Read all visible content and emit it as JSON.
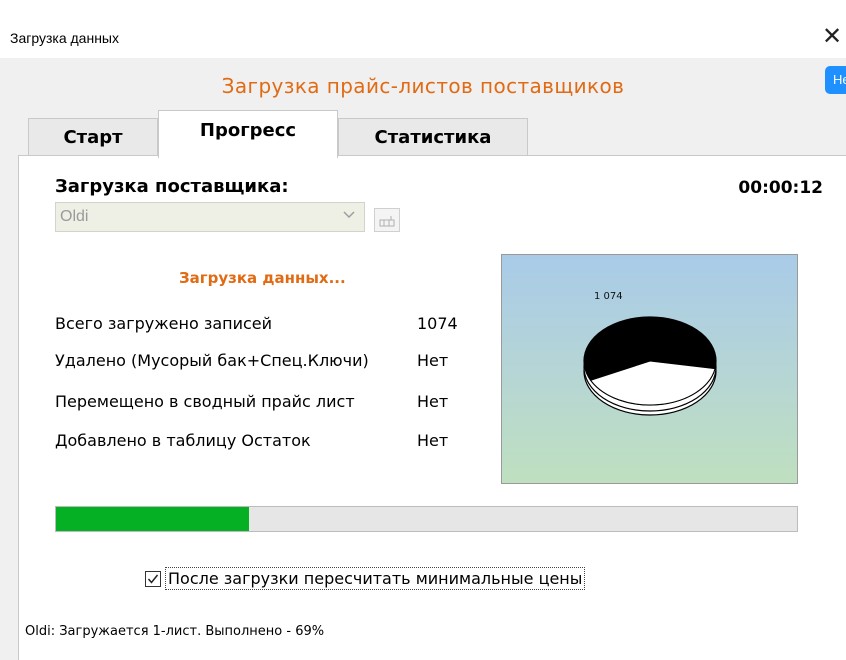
{
  "window": {
    "title": "Загрузка данных",
    "close_glyph": "✕"
  },
  "help_label": "Help",
  "heading": "Загрузка прайс-листов поставщиков",
  "tabs": [
    {
      "label": "Старт",
      "active": false
    },
    {
      "label": "Прогресс",
      "active": true
    },
    {
      "label": "Статистика",
      "active": false
    }
  ],
  "progress_tab": {
    "supplier_label": "Загрузка поставщика:",
    "timer": "00:00:12",
    "supplier_select": {
      "value": "Oldi"
    },
    "loading_text": "Загрузка данных...",
    "stats": [
      {
        "label": "Всего загружено записей",
        "value": "1074"
      },
      {
        "label": "Удалено (Мусорый бак+Спец.Ключи)",
        "value": "Нет"
      },
      {
        "label": "Перемещено в сводный прайс лист",
        "value": "Нет"
      },
      {
        "label": "Добавлено в таблицу Остаток",
        "value": "Нет"
      }
    ],
    "pie_chart": {
      "label": "1 074",
      "black_fraction": 0.6,
      "colors": {
        "filled": "#000000",
        "empty": "#ffffff"
      }
    },
    "progress_fraction": 0.26,
    "progress_color": "#06b025",
    "recalc_checkbox": {
      "checked": true,
      "label": "После загрузки пересчитать минимальные цены"
    }
  },
  "status_line": "Oldi:  Загружается 1-лист.   Выполнено - 69%",
  "colors": {
    "accent_orange": "#e06b14",
    "help_blue": "#1e90ff"
  }
}
